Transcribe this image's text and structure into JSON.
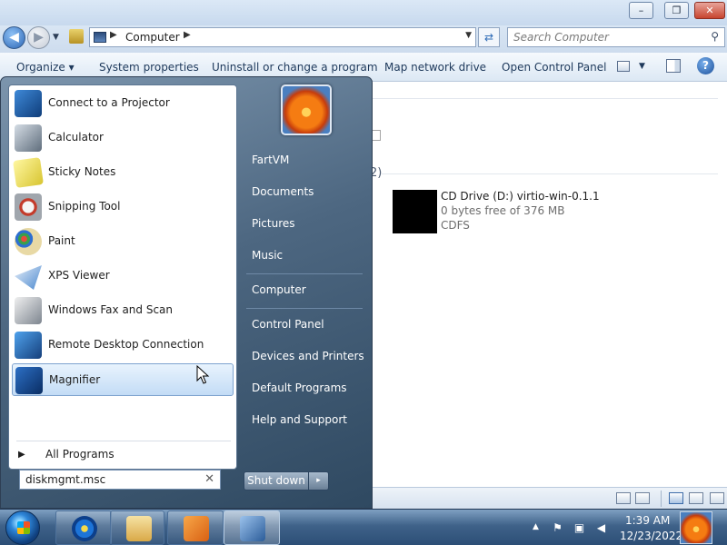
{
  "window": {
    "caption": {
      "minimize": "–",
      "maximize": "❐",
      "close": "✕"
    }
  },
  "address": {
    "path": "Computer",
    "search_placeholder": "Search Computer"
  },
  "toolbar": {
    "organize": "Organize ▾",
    "system_properties": "System properties",
    "uninstall": "Uninstall or change a program",
    "map_drive": "Map network drive",
    "control_panel": "Open Control Panel",
    "help": "?"
  },
  "content": {
    "group_tail": "2)",
    "drive": {
      "name": "CD Drive (D:) virtio-win-0.1.1",
      "free": "0 bytes free of 376 MB",
      "fs": "CDFS"
    }
  },
  "start_menu": {
    "programs": [
      {
        "label": "Connect to a Projector",
        "icon": "projector-icon"
      },
      {
        "label": "Calculator",
        "icon": "calculator-icon"
      },
      {
        "label": "Sticky Notes",
        "icon": "sticky-notes-icon"
      },
      {
        "label": "Snipping Tool",
        "icon": "snipping-tool-icon"
      },
      {
        "label": "Paint",
        "icon": "paint-icon"
      },
      {
        "label": "XPS Viewer",
        "icon": "xps-viewer-icon"
      },
      {
        "label": "Windows Fax and Scan",
        "icon": "fax-icon"
      },
      {
        "label": "Remote Desktop Connection",
        "icon": "remote-desktop-icon"
      },
      {
        "label": "Magnifier",
        "icon": "magnifier-icon",
        "highlighted": true
      }
    ],
    "all_programs": "All Programs",
    "search_value": "diskmgmt.msc",
    "right_items": [
      "FartVM",
      "Documents",
      "Pictures",
      "Music",
      "Computer",
      "Control Panel",
      "Devices and Printers",
      "Default Programs",
      "Help and Support"
    ],
    "shutdown": "Shut down",
    "shutdown_arrow": "▸"
  },
  "taskbar": {
    "time": "1:39 AM",
    "date": "12/23/2022"
  },
  "colors": {
    "start_menu_bg": "#4d6781",
    "taskbar_bg": "#2c4e76",
    "highlight": "#c3dcf6",
    "accent": "#2d67b6"
  }
}
